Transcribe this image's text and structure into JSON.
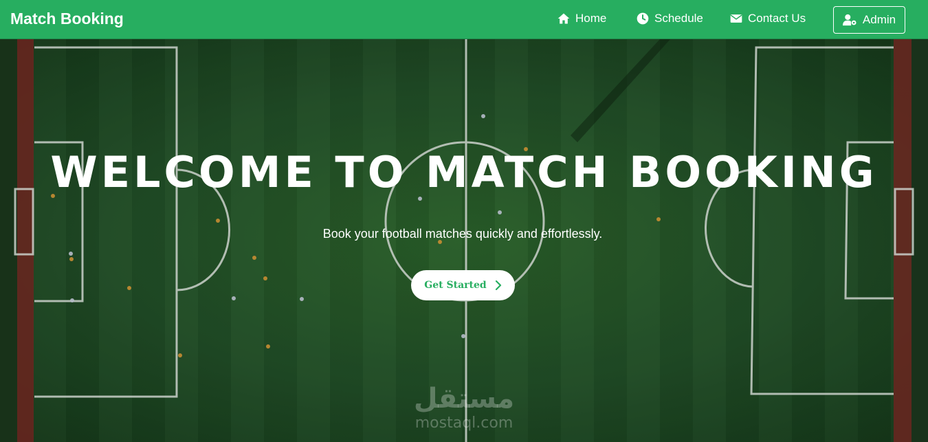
{
  "navbar": {
    "brand": "Match Booking",
    "links": [
      {
        "label": "Home",
        "icon": "home-icon"
      },
      {
        "label": "Schedule",
        "icon": "clock-icon"
      },
      {
        "label": "Contact Us",
        "icon": "envelope-icon"
      }
    ],
    "admin": {
      "label": "Admin",
      "icon": "user-cog-icon"
    },
    "background": "#27ae60"
  },
  "hero": {
    "title": "WELCOME TO MATCH BOOKING",
    "subtitle": "Book your football matches quickly and effortlessly.",
    "cta_label": "Get Started",
    "cta_icon": "chevron-right-icon",
    "accent": "#27ae60"
  },
  "watermark": {
    "arabic": "مستقل",
    "latin": "mostaql.com"
  }
}
